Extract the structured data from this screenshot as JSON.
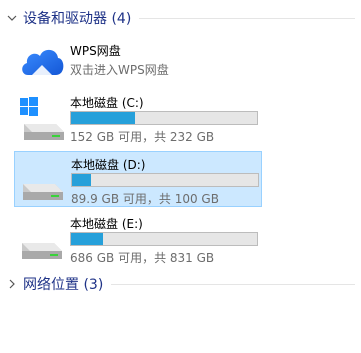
{
  "groups": {
    "devices": {
      "title": "设备和驱动器 (4)",
      "expanded": true
    },
    "network": {
      "title": "网络位置 (3)",
      "expanded": false
    }
  },
  "items": {
    "wps": {
      "name": "WPS网盘",
      "subtitle": "双击进入WPS网盘",
      "icon": "wps-cloud-icon"
    },
    "drive_c": {
      "name": "本地磁盘 (C:)",
      "free_text": "152 GB 可用，共 232 GB",
      "used_fraction": 0.345,
      "icon": "windows-drive-icon"
    },
    "drive_d": {
      "name": "本地磁盘 (D:)",
      "free_text": "89.9 GB 可用，共 100 GB",
      "used_fraction": 0.101,
      "selected": true,
      "icon": "hard-drive-icon"
    },
    "drive_e": {
      "name": "本地磁盘 (E:)",
      "free_text": "686 GB 可用，共 831 GB",
      "used_fraction": 0.174,
      "icon": "hard-drive-icon"
    }
  },
  "colors": {
    "header_text": "#1e3287",
    "bar_fill": "#26a0da",
    "bar_track": "#e6e6e6",
    "selection_bg": "#cce8ff",
    "selection_border": "#99d1ff",
    "cloud_blue": "#1e6fe8"
  }
}
